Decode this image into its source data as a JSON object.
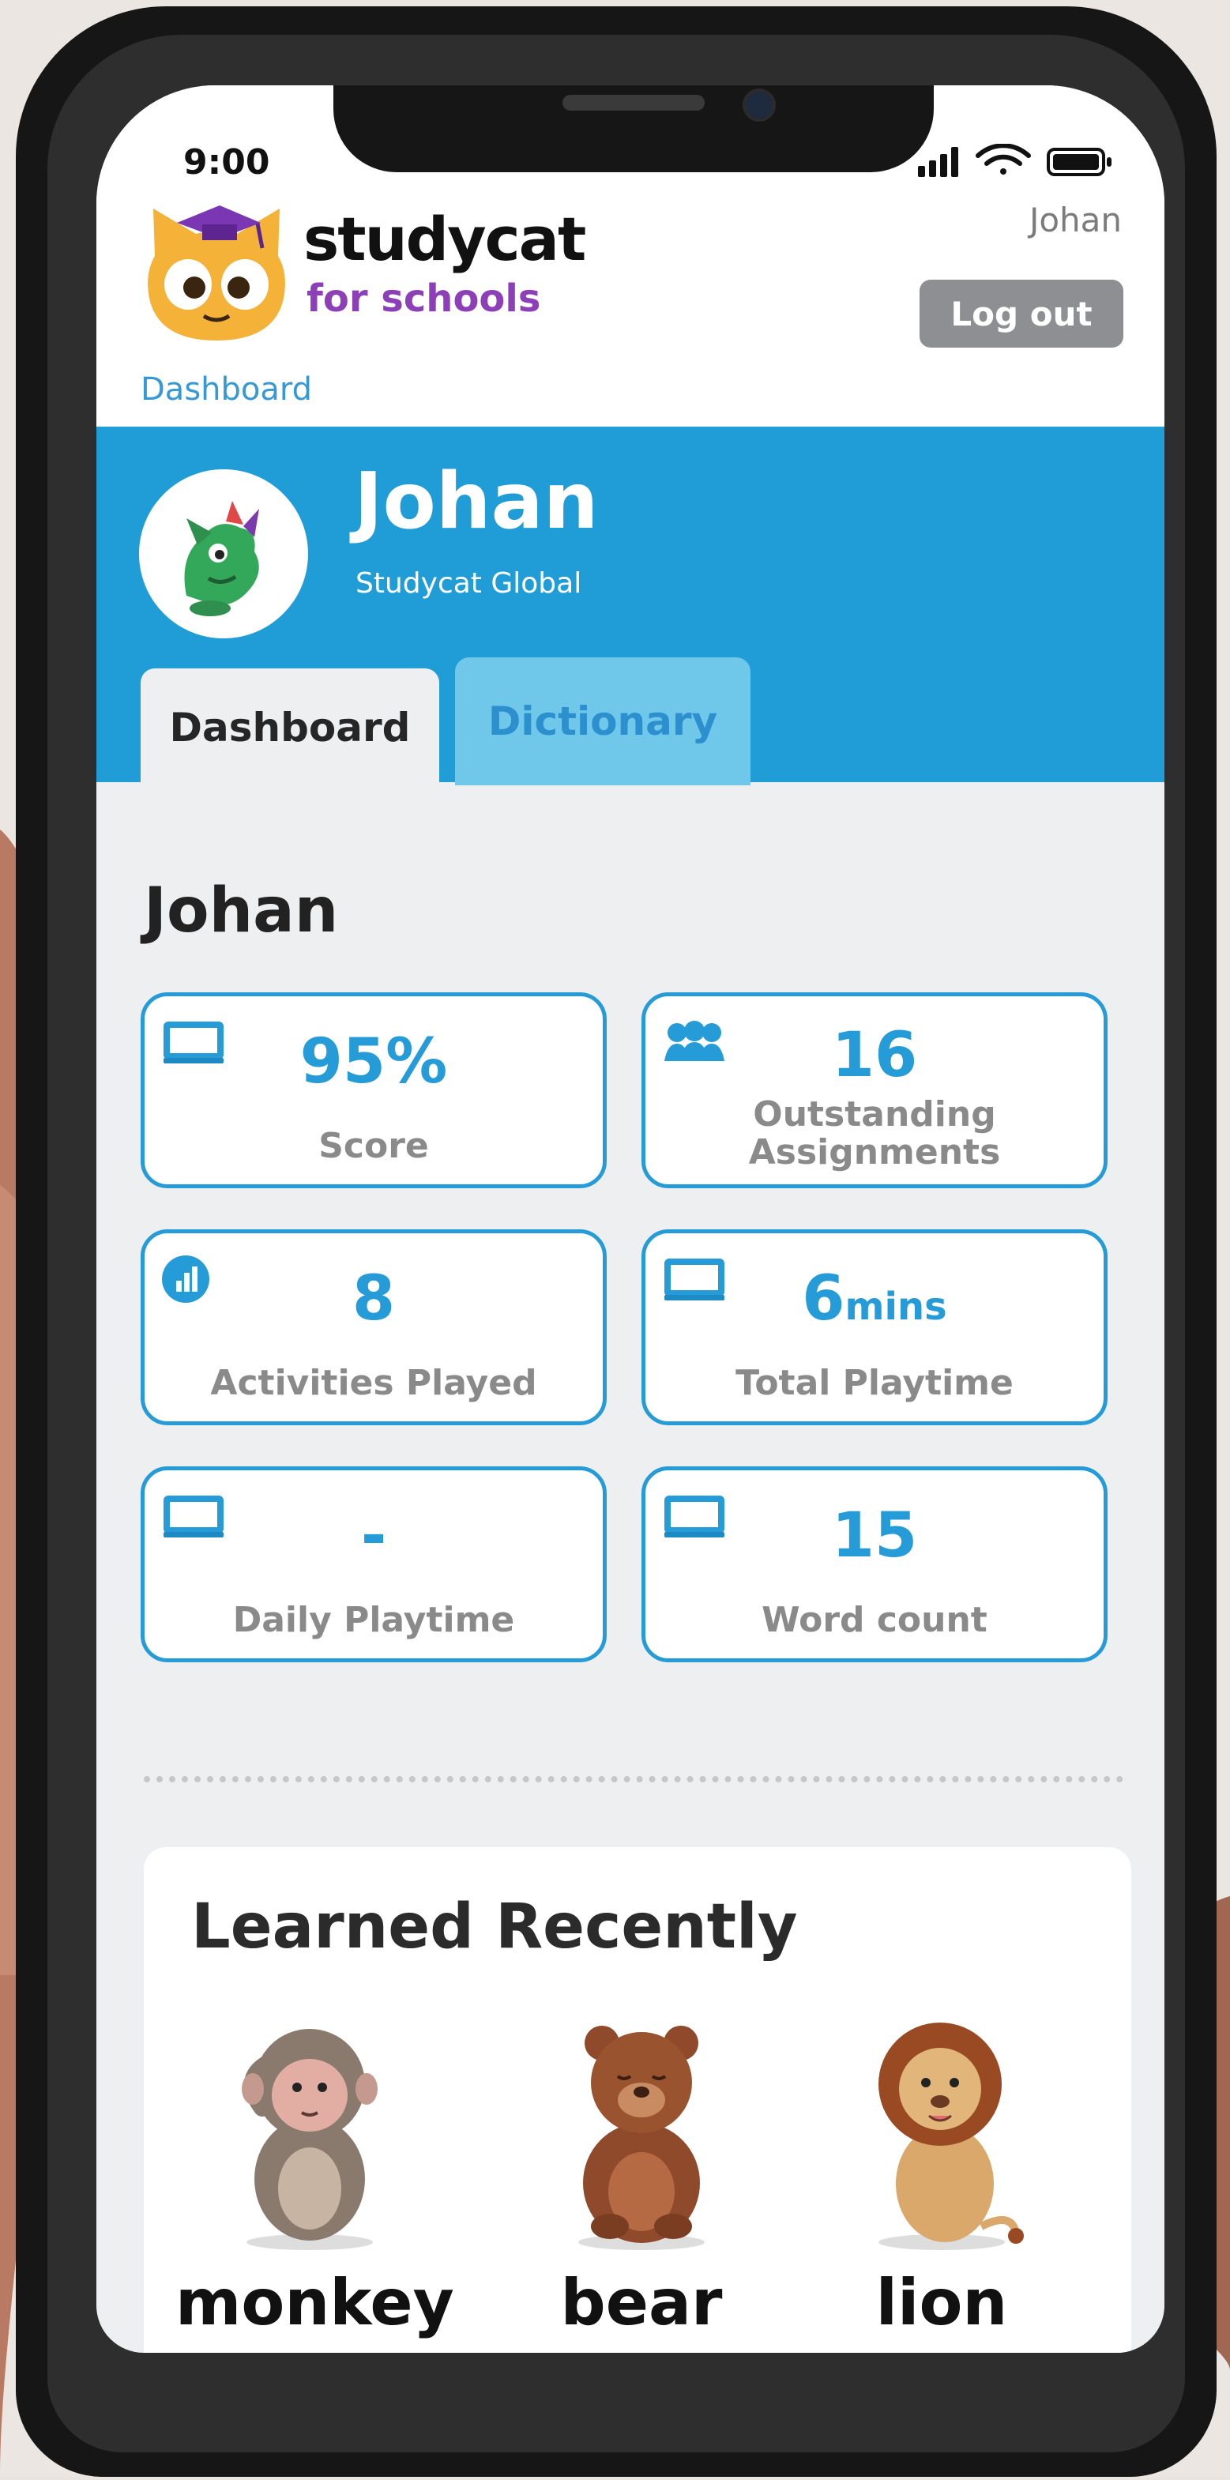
{
  "status_bar": {
    "time": "9:00"
  },
  "app": {
    "brand_line1": "studycat",
    "brand_line2": "for schools"
  },
  "user_menu": {
    "username": "Johan",
    "logout_label": "Log out"
  },
  "breadcrumb": {
    "current": "Dashboard"
  },
  "profile": {
    "name": "Johan",
    "organization": "Studycat Global"
  },
  "tabs": [
    {
      "label": "Dashboard",
      "active": true
    },
    {
      "label": "Dictionary",
      "active": false
    }
  ],
  "dashboard": {
    "title": "Johan",
    "stats": [
      {
        "value": "95%",
        "unit": "",
        "label": "Score",
        "icon": "screen-icon"
      },
      {
        "value": "16",
        "unit": "",
        "label_line1": "Outstanding",
        "label_line2": "Assignments",
        "icon": "group-icon"
      },
      {
        "value": "8",
        "unit": "",
        "label": "Activities Played",
        "icon": "chart-icon"
      },
      {
        "value": "6",
        "unit": "mins",
        "label": "Total Playtime",
        "icon": "screen-icon"
      },
      {
        "value": "-",
        "unit": "",
        "label": "Daily Playtime",
        "icon": "screen-icon"
      },
      {
        "value": "15",
        "unit": "",
        "label": "Word count",
        "icon": "screen-icon"
      }
    ]
  },
  "learned_recently": {
    "title": "Learned Recently",
    "words": [
      "monkey",
      "bear",
      "lion"
    ]
  },
  "colors": {
    "accent": "#209dd6",
    "brand_purple": "#8d3fb8",
    "card_border": "#259bd7"
  }
}
